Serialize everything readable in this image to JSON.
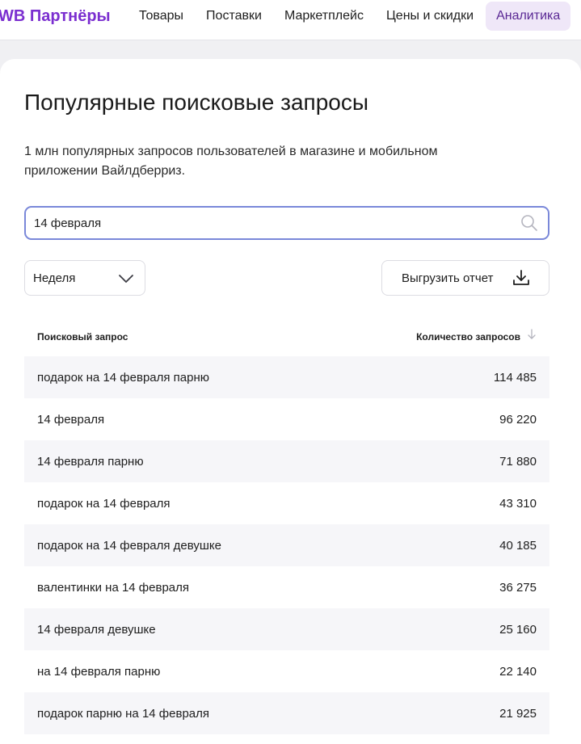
{
  "header": {
    "brand": "WB Партнёры",
    "nav": [
      {
        "label": "Товары"
      },
      {
        "label": "Поставки"
      },
      {
        "label": "Маркетплейс"
      },
      {
        "label": "Цены и скидки"
      },
      {
        "label": "Аналитика",
        "active": true
      }
    ]
  },
  "page": {
    "title": "Популярные поисковые запросы",
    "description": "1 млн популярных запросов пользователей в магазине и мобильном приложении Вайлдберриз."
  },
  "search": {
    "value": "14 февраля",
    "icon": "search-icon"
  },
  "period": {
    "selected": "Неделя",
    "icon": "chevron-down-icon"
  },
  "export": {
    "label": "Выгрузить отчет",
    "icon": "download-icon"
  },
  "table": {
    "columns": {
      "query": "Поисковый запрос",
      "count": "Количество запросов"
    },
    "rows": [
      {
        "query": "подарок на 14 февраля парню",
        "count": "114 485"
      },
      {
        "query": "14 февраля",
        "count": "96 220"
      },
      {
        "query": "14 февраля парню",
        "count": "71 880"
      },
      {
        "query": "подарок на 14 февраля",
        "count": "43 310"
      },
      {
        "query": "подарок на 14 февраля девушке",
        "count": "40 185"
      },
      {
        "query": "валентинки на 14 февраля",
        "count": "36 275"
      },
      {
        "query": "14 февраля девушке",
        "count": "25 160"
      },
      {
        "query": "на 14 февраля парню",
        "count": "22 140"
      },
      {
        "query": "подарок парню на 14 февраля",
        "count": "21 925"
      }
    ]
  },
  "colors": {
    "brand": "#7b2fd0",
    "active_nav_bg": "#efe7f8",
    "search_border": "#7a88d9",
    "row_stripe": "#f6f6f9"
  }
}
